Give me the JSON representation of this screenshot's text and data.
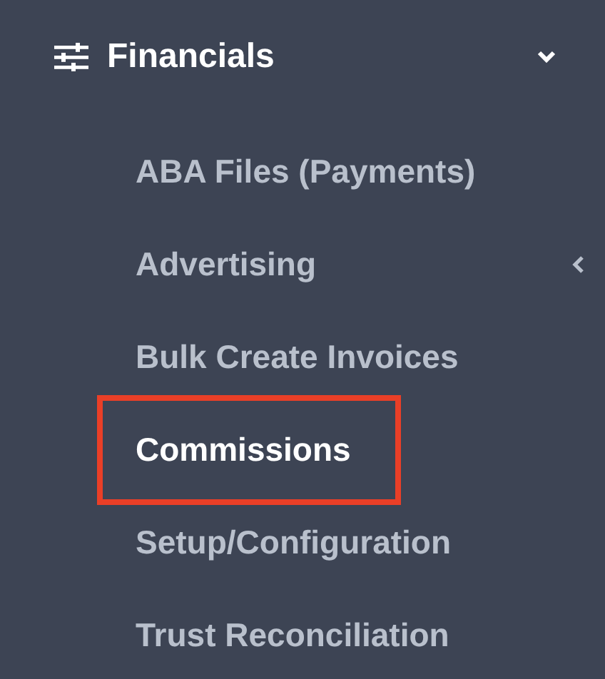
{
  "section": {
    "title": "Financials",
    "expanded": true
  },
  "items": [
    {
      "label": "ABA Files (Payments)",
      "selected": false,
      "has_submenu": false,
      "highlighted": false
    },
    {
      "label": "Advertising",
      "selected": false,
      "has_submenu": true,
      "highlighted": false
    },
    {
      "label": "Bulk Create Invoices",
      "selected": false,
      "has_submenu": false,
      "highlighted": false
    },
    {
      "label": "Commissions",
      "selected": true,
      "has_submenu": false,
      "highlighted": true
    },
    {
      "label": "Setup/Configuration",
      "selected": false,
      "has_submenu": false,
      "highlighted": false
    },
    {
      "label": "Trust Reconciliation",
      "selected": false,
      "has_submenu": false,
      "highlighted": false
    }
  ]
}
